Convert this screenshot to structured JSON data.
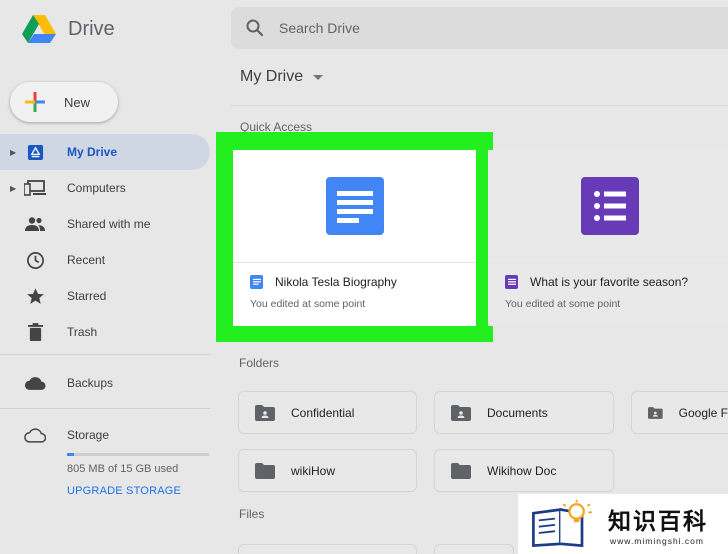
{
  "app": {
    "name": "Drive"
  },
  "search": {
    "placeholder": "Search Drive"
  },
  "sidebar": {
    "new_label": "New",
    "items": [
      {
        "label": "My Drive",
        "icon": "my-drive-icon",
        "active": true,
        "expandable": true
      },
      {
        "label": "Computers",
        "icon": "computers-icon",
        "active": false,
        "expandable": true
      },
      {
        "label": "Shared with me",
        "icon": "shared-icon",
        "active": false,
        "expandable": false
      },
      {
        "label": "Recent",
        "icon": "clock-icon",
        "active": false,
        "expandable": false
      },
      {
        "label": "Starred",
        "icon": "star-icon",
        "active": false,
        "expandable": false
      },
      {
        "label": "Trash",
        "icon": "trash-icon",
        "active": false,
        "expandable": false
      }
    ],
    "backups_label": "Backups",
    "storage": {
      "label": "Storage",
      "used_text": "805 MB of 15 GB used",
      "used_fraction": 0.052,
      "upgrade_label": "UPGRADE STORAGE"
    }
  },
  "main": {
    "title": "My Drive",
    "quick_access": {
      "label": "Quick Access",
      "items": [
        {
          "name": "Nikola Tesla Biography",
          "subtitle": "You edited at some point",
          "type": "docs",
          "highlighted": true
        },
        {
          "name": "What is your favorite season?",
          "subtitle": "You edited at some point",
          "type": "forms",
          "highlighted": false
        }
      ]
    },
    "folders": {
      "label": "Folders",
      "items": [
        {
          "name": "Confidential",
          "shared": true
        },
        {
          "name": "Documents",
          "shared": true
        },
        {
          "name": "Google F",
          "shared": true
        },
        {
          "name": "wikiHow",
          "shared": false
        },
        {
          "name": "Wikihow Doc",
          "shared": false
        }
      ]
    },
    "files_label": "Files"
  },
  "watermark": {
    "text": "知识百科",
    "url": "www.mimingshi.com"
  },
  "colors": {
    "docs_blue": "#4285f4",
    "forms_purple": "#673ab7",
    "highlight_green": "#23ee1f",
    "active_nav_bg": "#cfd7e5",
    "active_nav_text": "#1a56c4",
    "link_blue": "#1a73e8"
  }
}
